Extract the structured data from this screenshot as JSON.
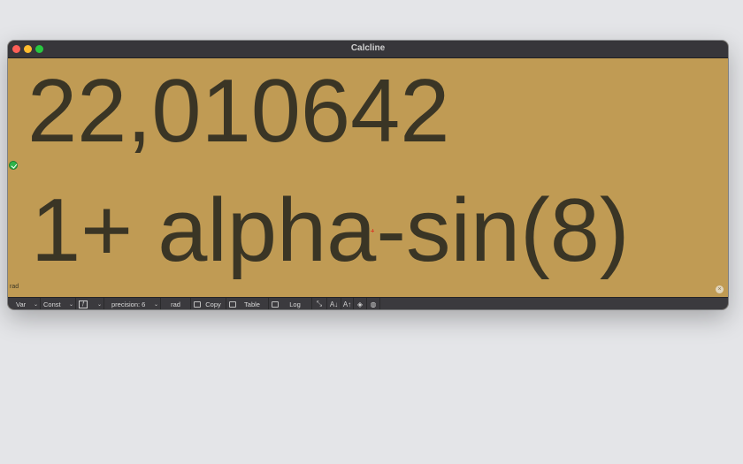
{
  "window": {
    "title": "Calcline"
  },
  "display": {
    "result": "22,010642",
    "expression": "1+ alpha-sin(8)",
    "mode_indicator": "rad",
    "text_color": "#3a3525",
    "background_color": "#c09b54",
    "status_icon": "check-circle-icon",
    "clear_icon": "clear-circle-icon"
  },
  "toolbar": {
    "var_label": "Var",
    "const_label": "Const",
    "function_icon": "function-icon",
    "precision_label": "precision: 6",
    "angle_label": "rad",
    "copy_label": "Copy",
    "table_label": "Table",
    "log_label": "Log",
    "icons": [
      "expand-icon",
      "decrease-font-icon",
      "increase-font-icon",
      "fill-color-icon",
      "palette-icon"
    ]
  }
}
